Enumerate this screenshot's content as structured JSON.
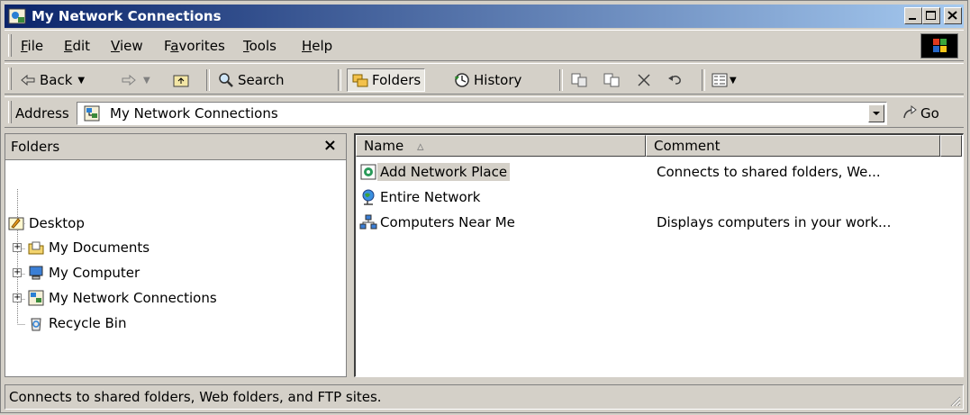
{
  "window": {
    "title": "My Network Connections",
    "controls": {
      "minimize": "_",
      "maximize": "□",
      "close": "×"
    }
  },
  "menu": {
    "items": [
      {
        "label": "File",
        "accel": "F"
      },
      {
        "label": "Edit",
        "accel": "E"
      },
      {
        "label": "View",
        "accel": "V"
      },
      {
        "label": "Favorites",
        "accel": "a"
      },
      {
        "label": "Tools",
        "accel": "T"
      },
      {
        "label": "Help",
        "accel": "H"
      }
    ]
  },
  "toolbar": {
    "back_label": "Back",
    "search_label": "Search",
    "folders_label": "Folders",
    "history_label": "History"
  },
  "address": {
    "label": "Address",
    "value": "My Network Connections",
    "go_label": "Go"
  },
  "folders_pane": {
    "title": "Folders",
    "close": "×",
    "tree": [
      {
        "label": "Desktop",
        "icon": "desktop-icon",
        "expandable": false
      },
      {
        "label": "My Documents",
        "icon": "my-documents-icon",
        "expandable": true
      },
      {
        "label": "My Computer",
        "icon": "my-computer-icon",
        "expandable": true
      },
      {
        "label": "My Network Connections",
        "icon": "network-connections-icon",
        "expandable": true
      },
      {
        "label": "Recycle Bin",
        "icon": "recycle-bin-icon",
        "expandable": false
      }
    ]
  },
  "list": {
    "columns": [
      "Name",
      "Comment"
    ],
    "sort_indicator": "▵",
    "rows": [
      {
        "name": "Add Network Place",
        "comment": "Connects to shared folders, We...",
        "icon": "add-network-place-icon",
        "selected": true
      },
      {
        "name": "Entire Network",
        "comment": "",
        "icon": "entire-network-icon",
        "selected": false
      },
      {
        "name": "Computers Near Me",
        "comment": "Displays computers in your work...",
        "icon": "computers-near-me-icon",
        "selected": false
      }
    ]
  },
  "status_bar": {
    "text": "Connects to shared folders, Web folders, and FTP sites."
  },
  "colors": {
    "titlebar_start": "#0a246a",
    "titlebar_end": "#a6caf0",
    "face": "#d4d0c8"
  }
}
